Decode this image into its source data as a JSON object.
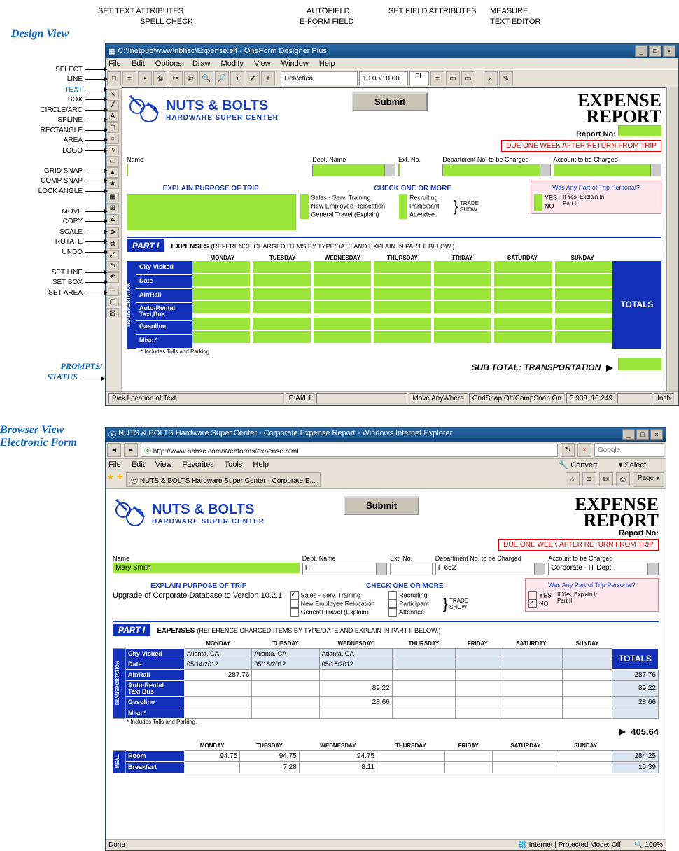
{
  "top_callouts": {
    "spell_check": "SPELL CHECK",
    "set_text_attributes": "SET TEXT ATTRIBUTES",
    "eform_field": "E-FORM FIELD",
    "autofield": "AUTOFIELD",
    "set_field_attributes": "SET FIELD ATTRIBUTES",
    "measure": "MEASURE",
    "text_editor": "TEXT EDITOR"
  },
  "design_view_label": "Design View",
  "browser_view_label1": "Browser View",
  "browser_view_label2": "Electronic Form",
  "prompts_label": "PROMPTS/\nSTATUS",
  "left_tools": [
    "SELECT",
    "LINE",
    "TEXT",
    "BOX",
    "CIRCLE/ARC",
    "SPLINE",
    "RECTANGLE",
    "AREA",
    "LOGO",
    "",
    "GRID SNAP",
    "COMP SNAP",
    "LOCK ANGLE",
    "",
    "MOVE",
    "COPY",
    "SCALE",
    "ROTATE",
    "UNDO",
    "",
    "SET LINE",
    "SET BOX",
    "SET AREA"
  ],
  "designer": {
    "title": "C:\\Inetpub\\www\\nbhsc\\Expense.elf - OneForm Designer Plus",
    "menus": [
      "File",
      "Edit",
      "Options",
      "Draw",
      "Modify",
      "View",
      "Window",
      "Help"
    ],
    "font_box": "Helvetica",
    "size_box": "10.00/10.00",
    "mode": "FL",
    "status_left": "Pick Location of Text",
    "status_2": "P:AI/L1",
    "status_3": "Move AnyWhere",
    "status_4": "GridSnap Off/CompSnap On",
    "status_5": "3.933, 10.249",
    "status_6": "Inch"
  },
  "form": {
    "brand_big": "NUTS & BOLTS",
    "brand_sub": "HARDWARE SUPER CENTER",
    "submit": "Submit",
    "title1": "EXPENSE",
    "title2": "REPORT",
    "report_no": "Report No:",
    "red_note": "DUE ONE WEEK AFTER RETURN FROM TRIP",
    "labels": {
      "name": "Name",
      "dept": "Dept. Name",
      "ext": "Ext. No.",
      "deptno": "Department No. to be Charged",
      "acct": "Account to be Charged"
    },
    "explain": "EXPLAIN PURPOSE OF TRIP",
    "check_one": "CHECK ONE OR MORE",
    "checks": [
      "Sales - Serv. Training",
      "New Employee Relocation",
      "General Travel (Explain)",
      "Recruiting",
      "Participant",
      "Attendee"
    ],
    "trade": "TRADE",
    "show": "SHOW",
    "personal_q": "Was Any Part of Trip Personal?",
    "yes": "YES",
    "no": "NO",
    "explain_in": "If Yes, Explain In",
    "partii": "Part II",
    "part1": "PART I",
    "expenses": "EXPENSES",
    "exp_note": "(REFERENCE CHARGED ITEMS BY TYPE/DATE AND EXPLAIN IN PART II BELOW.)",
    "days": [
      "MONDAY",
      "TUESDAY",
      "WEDNESDAY",
      "THURSDAY",
      "FRIDAY",
      "SATURDAY",
      "SUNDAY"
    ],
    "rows": [
      "City Visited",
      "Date",
      "Air/Rail",
      "Auto-Rental Taxi,Bus",
      "Gasoline",
      "Misc.*"
    ],
    "vcat": "TRANSPORTATION",
    "totals": "TOTALS",
    "foot": "* Includes Tolls and Parking.",
    "subtotal": "SUB TOTAL:",
    "subtotal_cat": "TRANSPORTATION"
  },
  "ie": {
    "title": "NUTS & BOLTS Hardware Super Center - Corporate Expense Report - Windows Internet Explorer",
    "url": "http://www.nbhsc.com/Webforms/expense.html",
    "search_placeholder": "Google",
    "menus": [
      "File",
      "Edit",
      "View",
      "Favorites",
      "Tools",
      "Help"
    ],
    "convert": "Convert",
    "select": "Select",
    "tab": "NUTS & BOLTS Hardware Super Center - Corporate E...",
    "page_btn": "Page",
    "status": "Done",
    "zone": "Internet | Protected Mode: Off",
    "zoom": "100%"
  },
  "filled": {
    "name": "Mary Smith",
    "dept": "IT",
    "deptno": "IT652",
    "acct": "Corporate - IT Dept.",
    "purpose": "Upgrade of Corporate Database to Version 10.2.1",
    "checked": [
      "Sales - Serv. Training"
    ],
    "personal_no": true,
    "grid": {
      "City Visited": [
        "Atlanta, GA",
        "Atlanta, GA",
        "Atlanta, GA",
        "",
        "",
        "",
        ""
      ],
      "Date": [
        "05/14/2012",
        "05/15/2012",
        "05/16/2012",
        "",
        "",
        "",
        ""
      ],
      "Air/Rail": [
        "287.76",
        "",
        "",
        "",
        "",
        "",
        ""
      ],
      "Auto-Rental Taxi,Bus": [
        "",
        "",
        "89.22",
        "",
        "",
        "",
        ""
      ],
      "Gasoline": [
        "",
        "",
        "28.66",
        "",
        "",
        "",
        ""
      ],
      "Misc.*": [
        "",
        "",
        "",
        "",
        "",
        "",
        ""
      ]
    },
    "totals": {
      "Air/Rail": "287.76",
      "Auto-Rental Taxi,Bus": "89.22",
      "Gasoline": "28.66"
    },
    "sub_total": "405.64",
    "meals_vcat": "MEAL",
    "meals_rows": [
      "Room",
      "Breakfast"
    ],
    "meals": {
      "Room": [
        "94.75",
        "94.75",
        "94.75",
        "",
        "",
        "",
        ""
      ],
      "Breakfast": [
        "",
        "7.28",
        "8.11",
        "",
        "",
        "",
        ""
      ]
    },
    "meals_totals": {
      "Room": "284.25",
      "Breakfast": "15.39"
    }
  }
}
